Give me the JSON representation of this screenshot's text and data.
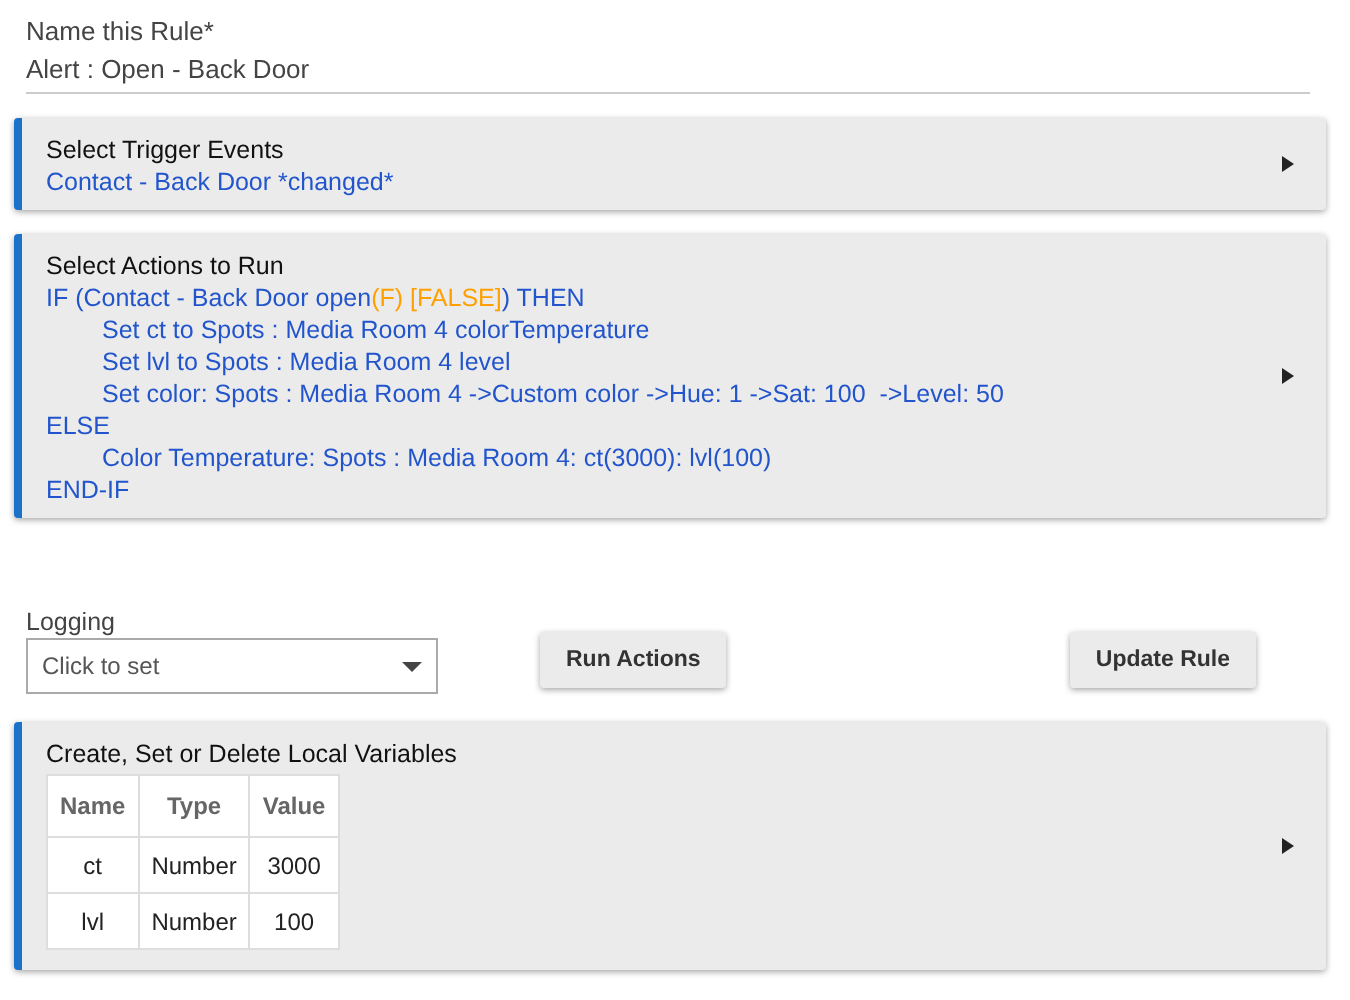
{
  "rule_name": {
    "label": "Name this Rule*",
    "value": "Alert : Open - Back Door"
  },
  "triggers": {
    "title": "Select Trigger Events",
    "lines": [
      "Contact - Back Door *changed*"
    ]
  },
  "actions": {
    "title": "Select Actions to Run",
    "blocks": [
      {
        "segments": [
          {
            "text": "IF (Contact - Back Door open",
            "color": "#2255cc"
          },
          {
            "text": "(F) [FALSE]",
            "color": "#ffa000"
          },
          {
            "text": ") THEN",
            "color": "#2255cc"
          }
        ],
        "children": [
          "Set ct to Spots : Media Room 4 colorTemperature",
          "Set lvl to Spots : Media Room 4 level",
          "Set color: Spots : Media Room 4 ->Custom color ->Hue: 1 ->Sat: 100  ->Level: 50"
        ]
      },
      {
        "segments": [
          {
            "text": "ELSE",
            "color": "#2255cc"
          }
        ],
        "children": [
          "Color Temperature: Spots : Media Room 4: ct(3000): lvl(100)"
        ]
      },
      {
        "segments": [
          {
            "text": "END-IF",
            "color": "#2255cc"
          }
        ]
      }
    ]
  },
  "logging": {
    "label": "Logging",
    "placeholder": "Click to set"
  },
  "buttons": [
    "Run Actions",
    "Update Rule"
  ],
  "variables": {
    "title": "Create, Set or Delete Local Variables",
    "columns": [
      "Name",
      "Type",
      "Value"
    ],
    "rows": [
      [
        "ct",
        "Number",
        "3000"
      ],
      [
        "lvl",
        "Number",
        "100"
      ]
    ]
  }
}
